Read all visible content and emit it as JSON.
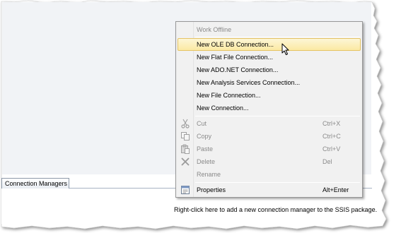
{
  "menu": {
    "items": [
      {
        "label": "Work Offline",
        "shortcut": "",
        "enabled": false
      },
      {
        "label": "New OLE DB Connection...",
        "shortcut": "",
        "enabled": true,
        "hovered": true
      },
      {
        "label": "New Flat File Connection...",
        "shortcut": "",
        "enabled": true
      },
      {
        "label": "New ADO.NET Connection...",
        "shortcut": "",
        "enabled": true
      },
      {
        "label": "New Analysis Services Connection...",
        "shortcut": "",
        "enabled": true
      },
      {
        "label": "New File Connection...",
        "shortcut": "",
        "enabled": true
      },
      {
        "label": "New Connection...",
        "shortcut": "",
        "enabled": true
      },
      {
        "label": "Cut",
        "shortcut": "Ctrl+X",
        "enabled": false,
        "icon": "scissors-icon"
      },
      {
        "label": "Copy",
        "shortcut": "Ctrl+C",
        "enabled": false,
        "icon": "copy-icon"
      },
      {
        "label": "Paste",
        "shortcut": "Ctrl+V",
        "enabled": false,
        "icon": "paste-icon"
      },
      {
        "label": "Delete",
        "shortcut": "Del",
        "enabled": false,
        "icon": "delete-x-icon"
      },
      {
        "label": "Rename",
        "shortcut": "",
        "enabled": false
      },
      {
        "label": "Properties",
        "shortcut": "Alt+Enter",
        "enabled": true,
        "icon": "properties-icon"
      }
    ]
  },
  "tabs": {
    "connection_managers": "Connection Managers"
  },
  "panel": {
    "hint": "Right-click here to add a new connection manager to the SSIS package."
  },
  "colors": {
    "menu_background": "#f1f1f1",
    "hover_highlight": "#fbe9a3",
    "disabled_text": "#8a8a8a",
    "designer_background": "#f1f3f6"
  }
}
